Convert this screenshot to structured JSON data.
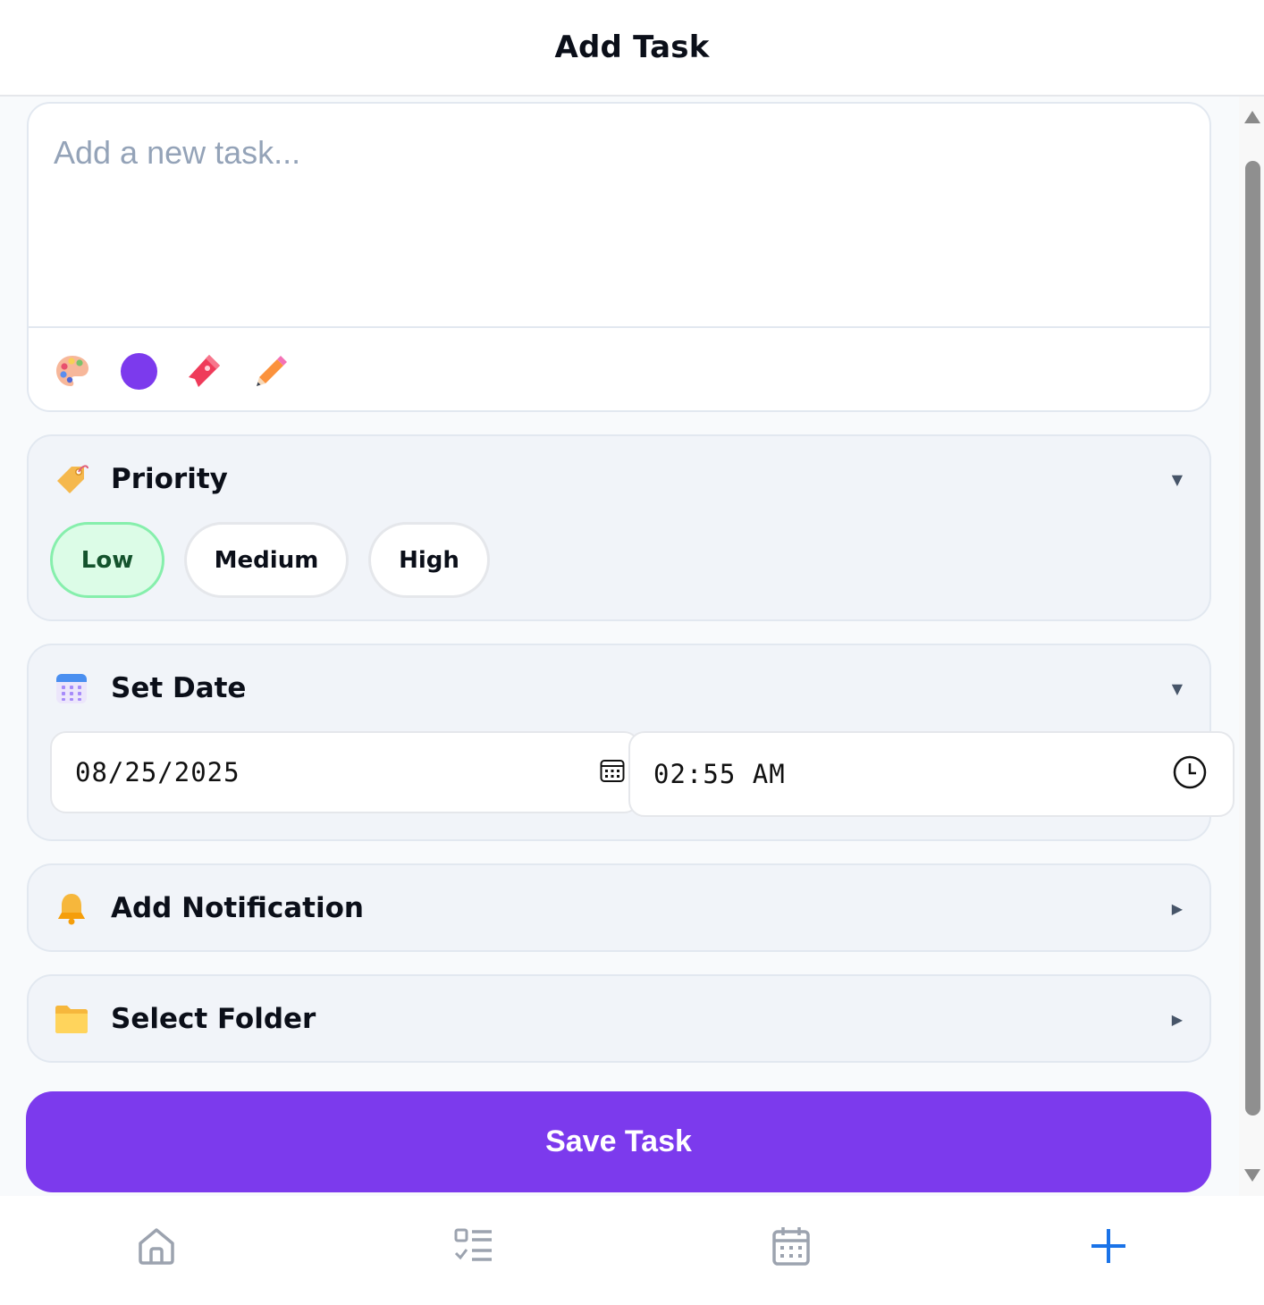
{
  "header": {
    "title": "Add Task"
  },
  "task": {
    "placeholder": "Add a new task...",
    "value": "",
    "tools": [
      "palette-icon",
      "color-dot",
      "bookmark-icon",
      "pencil-icon"
    ],
    "selected_color": "#7c3aed"
  },
  "priority": {
    "title": "Priority",
    "icon": "tag-icon",
    "expanded": true,
    "options": [
      "Low",
      "Medium",
      "High"
    ],
    "selected": "Low"
  },
  "set_date": {
    "title": "Set Date",
    "icon": "calendar-icon",
    "expanded": true,
    "date": "08/25/2025",
    "time": "02:55 AM"
  },
  "notification": {
    "title": "Add Notification",
    "icon": "bell-icon",
    "expanded": false
  },
  "folder": {
    "title": "Select Folder",
    "icon": "folder-icon",
    "expanded": false
  },
  "save_button": {
    "label": "Save Task"
  },
  "bottom_nav": {
    "items": [
      "home-icon",
      "tasks-list-icon",
      "calendar-icon",
      "add-icon"
    ],
    "active": "add-icon"
  },
  "colors": {
    "accent": "#7c3aed",
    "active_nav": "#1a73e8",
    "priority_low_bg": "#dcfce7",
    "priority_low_border": "#86efac"
  }
}
